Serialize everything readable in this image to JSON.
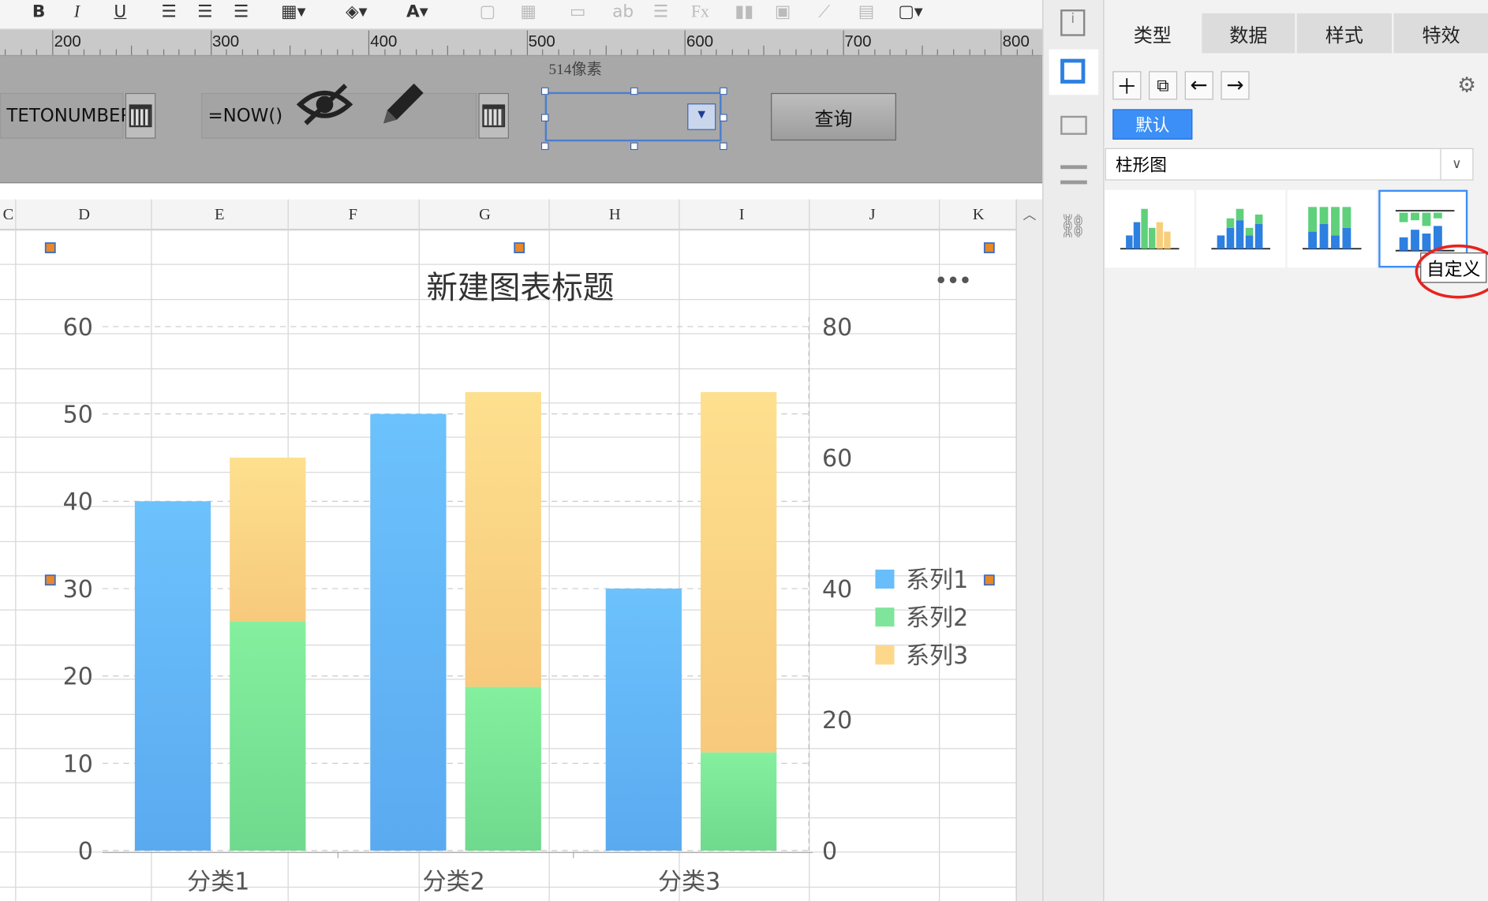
{
  "ruler": {
    "labels": [
      "200",
      "300",
      "400",
      "500",
      "600",
      "700",
      "800"
    ],
    "px_note": "514像素"
  },
  "params": {
    "field1": "TETONUMBER",
    "field2": "=NOW()",
    "query_label": "查询"
  },
  "sheet": {
    "columns": [
      "C",
      "D",
      "E",
      "F",
      "G",
      "H",
      "I",
      "J",
      "K"
    ]
  },
  "chart_data": {
    "type": "bar",
    "title": "新建图表标题",
    "categories": [
      "分类1",
      "分类2",
      "分类3"
    ],
    "series": [
      {
        "name": "系列1",
        "axis": "left",
        "stack": "a",
        "values": [
          40,
          50,
          30
        ]
      },
      {
        "name": "系列2",
        "axis": "right",
        "stack": "b",
        "values": [
          35,
          25,
          15
        ]
      },
      {
        "name": "系列3",
        "axis": "right",
        "stack": "b",
        "values": [
          25,
          45,
          55
        ]
      }
    ],
    "ylim_left": [
      0,
      60
    ],
    "yticks_left": [
      "0",
      "10",
      "20",
      "30",
      "40",
      "50",
      "60"
    ],
    "ylim_right": [
      0,
      80
    ],
    "yticks_right": [
      "0",
      "20",
      "40",
      "60",
      "80"
    ],
    "colors": [
      "#68bdfb",
      "#7fe59b",
      "#fdd88a"
    ],
    "legend": "right",
    "more_icon": "ellipsis-icon"
  },
  "panel": {
    "tabs": [
      "类型",
      "数据",
      "样式",
      "特效"
    ],
    "default_tag": "默认",
    "chart_type": "柱形图",
    "tooltip": "自定义"
  }
}
